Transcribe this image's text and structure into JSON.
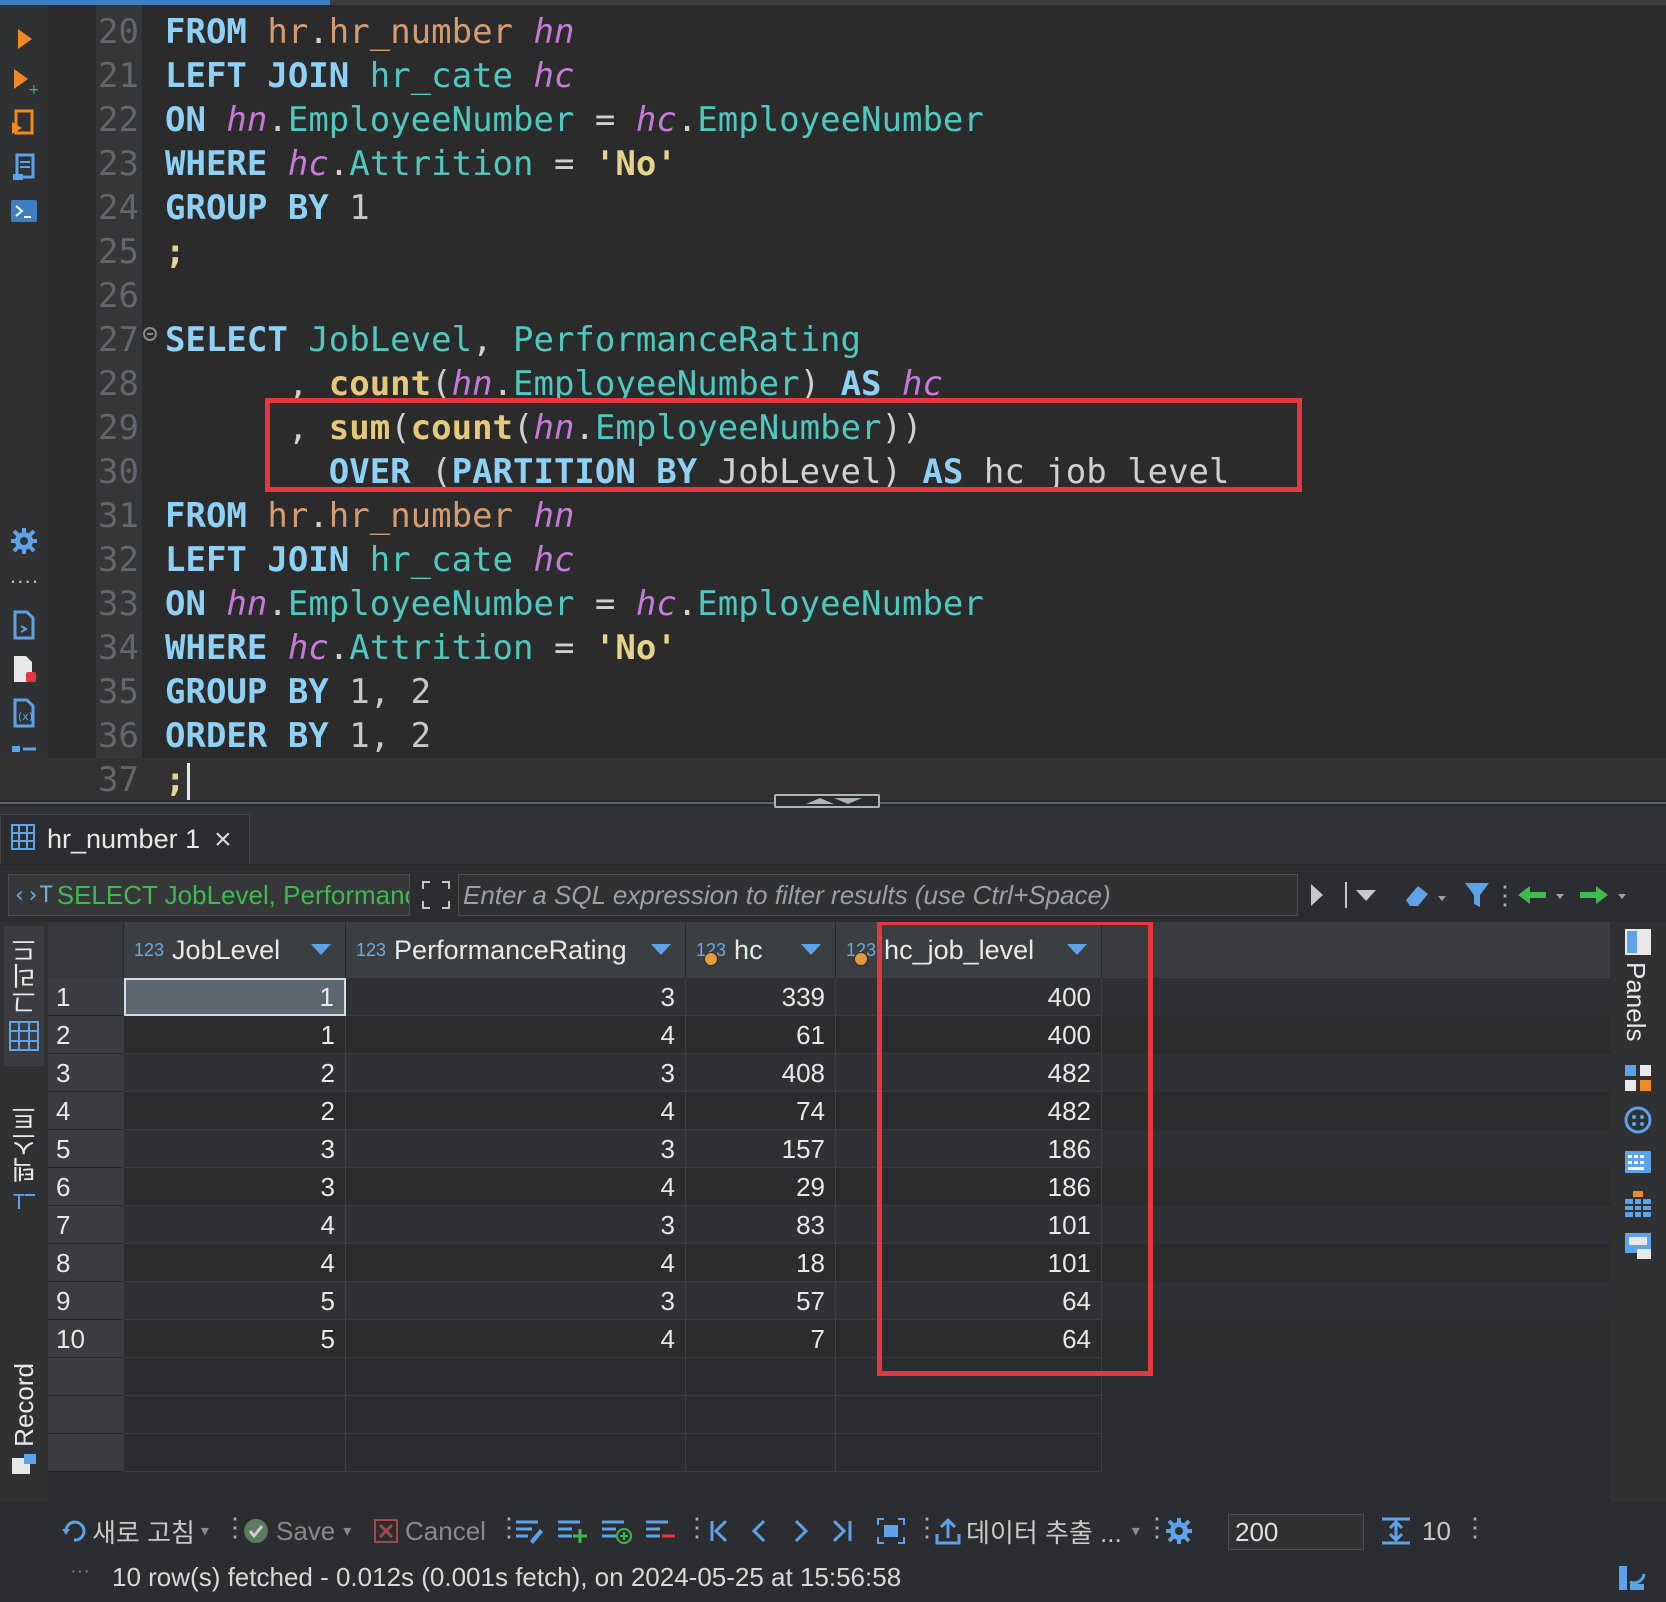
{
  "editor": {
    "lines": [
      {
        "n": "20",
        "tokens": [
          [
            "kw",
            "FROM "
          ],
          [
            "sch",
            "hr"
          ],
          [
            "pl",
            "."
          ],
          [
            "sch",
            "hr_number "
          ],
          [
            "al",
            "hn"
          ]
        ]
      },
      {
        "n": "21",
        "tokens": [
          [
            "kw",
            "LEFT JOIN "
          ],
          [
            "id",
            "hr_cate "
          ],
          [
            "al",
            "hc"
          ]
        ]
      },
      {
        "n": "22",
        "tokens": [
          [
            "kw",
            "ON "
          ],
          [
            "al",
            "hn"
          ],
          [
            "pl",
            "."
          ],
          [
            "id",
            "EmployeeNumber "
          ],
          [
            "pl",
            "= "
          ],
          [
            "al",
            "hc"
          ],
          [
            "pl",
            "."
          ],
          [
            "id",
            "EmployeeNumber"
          ]
        ]
      },
      {
        "n": "23",
        "tokens": [
          [
            "kw",
            "WHERE "
          ],
          [
            "al",
            "hc"
          ],
          [
            "pl",
            "."
          ],
          [
            "id",
            "Attrition "
          ],
          [
            "pl",
            "= "
          ],
          [
            "str",
            "'No'"
          ]
        ]
      },
      {
        "n": "24",
        "tokens": [
          [
            "kw",
            "GROUP BY "
          ],
          [
            "num",
            "1"
          ]
        ]
      },
      {
        "n": "25",
        "tokens": [
          [
            "str",
            ";"
          ]
        ]
      },
      {
        "n": "26",
        "tokens": []
      },
      {
        "n": "27",
        "tokens": [
          [
            "kw",
            "SELECT "
          ],
          [
            "id",
            "JobLevel"
          ],
          [
            "pl",
            ", "
          ],
          [
            "id",
            "PerformanceRating"
          ]
        ]
      },
      {
        "n": "28",
        "tokens": [
          [
            "pl",
            "      , "
          ],
          [
            "fn",
            "count"
          ],
          [
            "pl",
            "("
          ],
          [
            "al",
            "hn"
          ],
          [
            "pl",
            "."
          ],
          [
            "id",
            "EmployeeNumber"
          ],
          [
            "pl",
            ") "
          ],
          [
            "kw",
            "AS "
          ],
          [
            "al",
            "hc"
          ]
        ]
      },
      {
        "n": "29",
        "tokens": [
          [
            "pl",
            "      , "
          ],
          [
            "fn",
            "sum"
          ],
          [
            "pl",
            "("
          ],
          [
            "fn",
            "count"
          ],
          [
            "pl",
            "("
          ],
          [
            "al",
            "hn"
          ],
          [
            "pl",
            "."
          ],
          [
            "id",
            "EmployeeNumber"
          ],
          [
            "pl",
            "))"
          ]
        ]
      },
      {
        "n": "30",
        "tokens": [
          [
            "pl",
            "        "
          ],
          [
            "kw",
            "OVER "
          ],
          [
            "pl",
            "("
          ],
          [
            "kw",
            "PARTITION BY "
          ],
          [
            "pl",
            "JobLevel) "
          ],
          [
            "kw",
            "AS "
          ],
          [
            "pl",
            "hc_job_level"
          ]
        ]
      },
      {
        "n": "31",
        "tokens": [
          [
            "kw",
            "FROM "
          ],
          [
            "sch",
            "hr"
          ],
          [
            "pl",
            "."
          ],
          [
            "sch",
            "hr_number "
          ],
          [
            "al",
            "hn"
          ]
        ]
      },
      {
        "n": "32",
        "tokens": [
          [
            "kw",
            "LEFT JOIN "
          ],
          [
            "id",
            "hr_cate "
          ],
          [
            "al",
            "hc"
          ]
        ]
      },
      {
        "n": "33",
        "tokens": [
          [
            "kw",
            "ON "
          ],
          [
            "al",
            "hn"
          ],
          [
            "pl",
            "."
          ],
          [
            "id",
            "EmployeeNumber "
          ],
          [
            "pl",
            "= "
          ],
          [
            "al",
            "hc"
          ],
          [
            "pl",
            "."
          ],
          [
            "id",
            "EmployeeNumber"
          ]
        ]
      },
      {
        "n": "34",
        "tokens": [
          [
            "kw",
            "WHERE "
          ],
          [
            "al",
            "hc"
          ],
          [
            "pl",
            "."
          ],
          [
            "id",
            "Attrition "
          ],
          [
            "pl",
            "= "
          ],
          [
            "str",
            "'No'"
          ]
        ]
      },
      {
        "n": "35",
        "tokens": [
          [
            "kw",
            "GROUP BY "
          ],
          [
            "num",
            "1, 2"
          ]
        ]
      },
      {
        "n": "36",
        "tokens": [
          [
            "kw",
            "ORDER BY "
          ],
          [
            "num",
            "1, 2"
          ]
        ]
      },
      {
        "n": "37",
        "tokens": [
          [
            "str",
            ";"
          ]
        ]
      }
    ]
  },
  "results": {
    "tab_label": "hr_number 1",
    "tab_close": "×",
    "query_icon": "‹›T",
    "query_text": "SELECT JobLevel, Performanc",
    "filter_placeholder": "Enter a SQL expression to filter results (use Ctrl+Space)",
    "type_badge": "123",
    "columns": [
      "JobLevel",
      "PerformanceRating",
      "hc",
      "hc_job_level"
    ],
    "rows": [
      [
        "1",
        "1",
        "3",
        "339",
        "400"
      ],
      [
        "2",
        "1",
        "4",
        "61",
        "400"
      ],
      [
        "3",
        "2",
        "3",
        "408",
        "482"
      ],
      [
        "4",
        "2",
        "4",
        "74",
        "482"
      ],
      [
        "5",
        "3",
        "3",
        "157",
        "186"
      ],
      [
        "6",
        "3",
        "4",
        "29",
        "186"
      ],
      [
        "7",
        "4",
        "3",
        "83",
        "101"
      ],
      [
        "8",
        "4",
        "4",
        "18",
        "101"
      ],
      [
        "9",
        "5",
        "3",
        "57",
        "64"
      ],
      [
        "10",
        "5",
        "4",
        "7",
        "64"
      ]
    ],
    "side_tabs": {
      "grid": "그리드",
      "text": "텍스트",
      "record": "Record"
    },
    "panels_label": "Panels"
  },
  "toolbar": {
    "refresh": "새로 고침",
    "save": "Save",
    "cancel": "Cancel",
    "export": "데이터 추출 ...",
    "fetch_size": "200",
    "row_count": "10"
  },
  "status": {
    "dots": "···",
    "text": "10 row(s) fetched - 0.012s (0.001s fetch), on 2024-05-25 at 15:56:58"
  },
  "colors": {
    "highlight": "#e5373f",
    "keyword": "#8fd1f5",
    "alias": "#c57bd9",
    "identifier": "#4fc8c0"
  }
}
